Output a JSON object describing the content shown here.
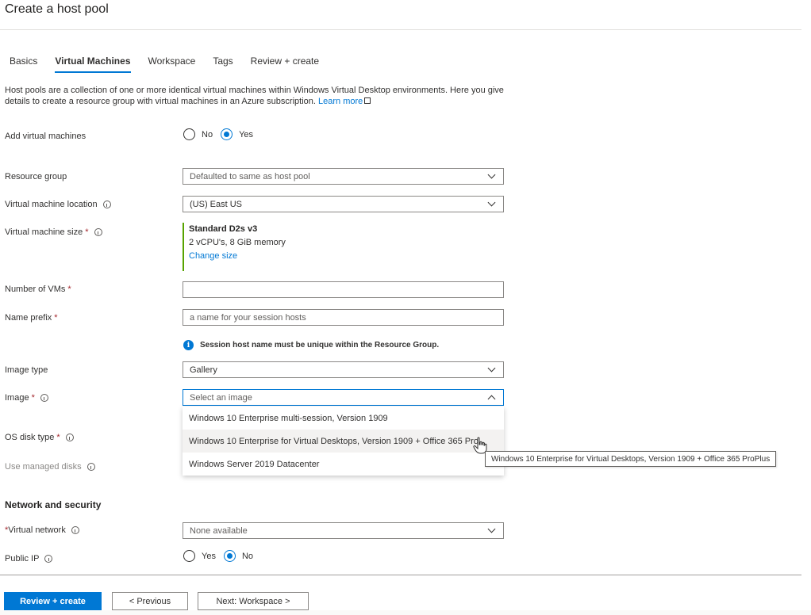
{
  "page": {
    "title": "Create a host pool"
  },
  "tabs": [
    {
      "label": "Basics",
      "active": false
    },
    {
      "label": "Virtual Machines",
      "active": true
    },
    {
      "label": "Workspace",
      "active": false
    },
    {
      "label": "Tags",
      "active": false
    },
    {
      "label": "Review + create",
      "active": false
    }
  ],
  "description": {
    "text": "Host pools are a collection of one or more identical virtual machines within Windows Virtual Desktop environments. Here you give details to create a resource group with virtual machines in an Azure subscription.",
    "link_label": "Learn more",
    "link_icon": "external-link-icon"
  },
  "form": {
    "add_vms": {
      "label": "Add virtual machines",
      "options": [
        "No",
        "Yes"
      ],
      "selected": "Yes"
    },
    "resource_group": {
      "label": "Resource group",
      "value": "Defaulted to same as host pool"
    },
    "vm_location": {
      "label": "Virtual machine location",
      "value": "(US) East US"
    },
    "vm_size": {
      "label": "Virtual machine size",
      "required": "*",
      "size_name": "Standard D2s v3",
      "size_detail": "2 vCPU's, 8 GiB memory",
      "change_label": "Change size",
      "accent_color": "#57a300"
    },
    "num_vms": {
      "label": "Number of VMs",
      "required": "*",
      "value": ""
    },
    "name_prefix": {
      "label": "Name prefix",
      "required": "*",
      "placeholder": "a name for your session hosts",
      "info_message": "Session host name must be unique within the Resource Group."
    },
    "image_type": {
      "label": "Image type",
      "value": "Gallery"
    },
    "image": {
      "label": "Image",
      "required": "*",
      "placeholder": "Select an image",
      "options": [
        "Windows 10 Enterprise multi-session, Version 1909",
        "Windows 10 Enterprise for Virtual Desktops, Version 1909 + Office 365 Pro...",
        "Windows Server 2019 Datacenter"
      ],
      "hovered_index": 1,
      "tooltip": "Windows 10 Enterprise for Virtual Desktops, Version 1909 + Office 365 ProPlus"
    },
    "os_disk_type": {
      "label": "OS disk type",
      "required": "*"
    },
    "managed_disks": {
      "label": "Use managed disks"
    }
  },
  "network": {
    "section_title": "Network and security",
    "virtual_network": {
      "required": "*",
      "label": "Virtual network",
      "value": "None available"
    },
    "public_ip": {
      "label": "Public IP",
      "options": [
        "Yes",
        "No"
      ],
      "selected": "No"
    }
  },
  "footer": {
    "review_create": "Review + create",
    "previous": "< Previous",
    "next": "Next: Workspace >"
  },
  "colors": {
    "accent": "#0078d4",
    "required": "#a4262c"
  }
}
